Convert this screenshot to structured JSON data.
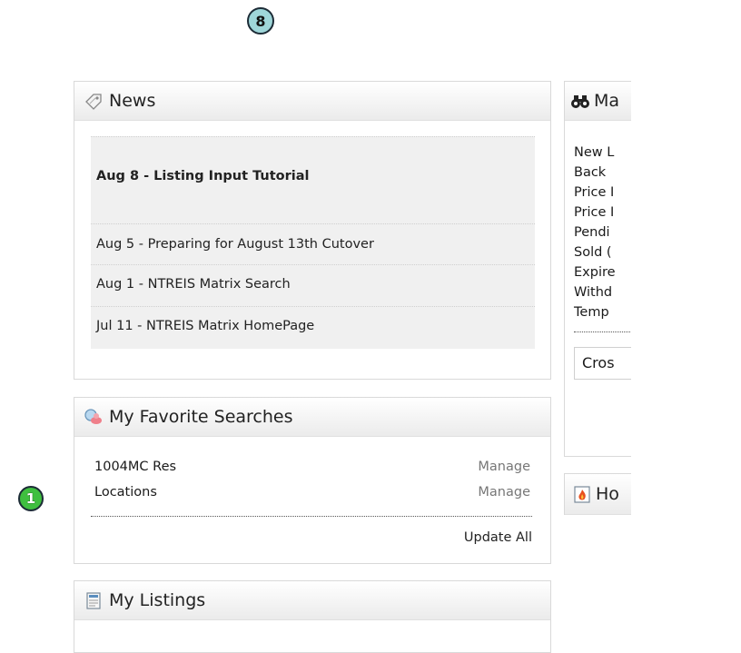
{
  "badges": {
    "top": "8",
    "left": "1"
  },
  "news": {
    "title": "News",
    "items": [
      "Aug 8 - Listing Input Tutorial",
      "Aug 5 - Preparing for August 13th Cutover",
      "Aug 1 - NTREIS Matrix Search",
      "Jul 11 - NTREIS Matrix HomePage"
    ]
  },
  "favorites": {
    "title": "My Favorite Searches",
    "rows": [
      {
        "name": "1004MC Res",
        "action": "Manage"
      },
      {
        "name": "Locations",
        "action": "Manage"
      }
    ],
    "update_all": "Update All"
  },
  "listings": {
    "title": "My Listings"
  },
  "market": {
    "title": "Ma",
    "rows": [
      "New L",
      "Back",
      "Price I",
      "Price I",
      "Pendi",
      "Sold (",
      "Expire",
      "Withd",
      "Temp"
    ],
    "input_value": "Cros"
  },
  "hot": {
    "title": "Ho"
  }
}
